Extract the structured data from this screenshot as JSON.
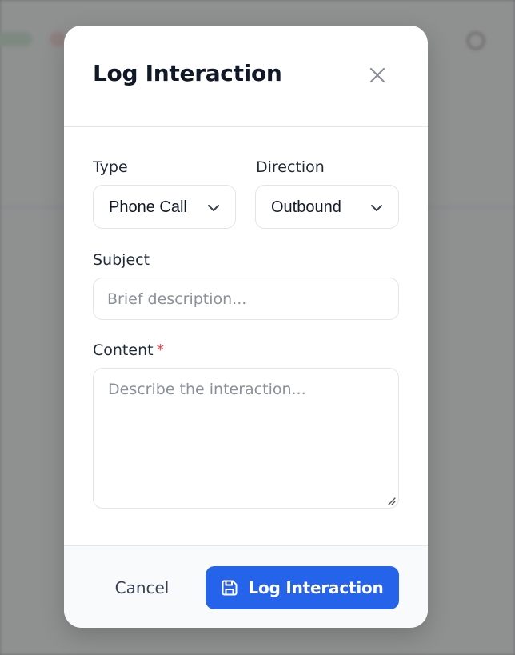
{
  "colors": {
    "primary": "#2563eb",
    "required": "#ef4444",
    "title": "#111827",
    "placeholder": "#8a9099",
    "overlay": "rgba(95,95,95,0.68)"
  },
  "modal": {
    "title": "Log Interaction",
    "close_icon": "close-icon",
    "fields": {
      "type": {
        "label": "Type",
        "value": "Phone Call",
        "icon": "chevron-down-icon"
      },
      "direction": {
        "label": "Direction",
        "value": "Outbound",
        "icon": "chevron-down-icon"
      },
      "subject": {
        "label": "Subject",
        "placeholder": "Brief description..."
      },
      "content": {
        "label": "Content",
        "required_mark": "*",
        "placeholder": "Describe the interaction..."
      }
    },
    "footer": {
      "cancel_label": "Cancel",
      "submit_label": "Log Interaction",
      "submit_icon": "save-icon"
    }
  }
}
